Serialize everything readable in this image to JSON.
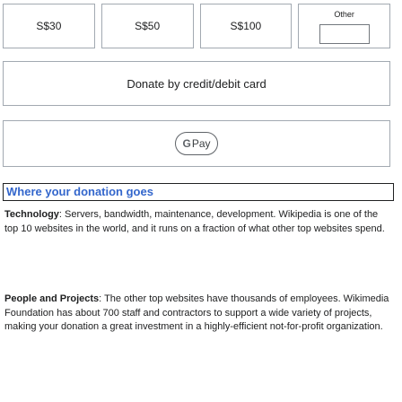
{
  "amounts": {
    "options": [
      "S$30",
      "S$50",
      "S$100"
    ],
    "other_label": "Other",
    "other_value": "",
    "other_placeholder": ""
  },
  "payment": {
    "card_label": "Donate by credit/debit card",
    "gpay_label": "Pay"
  },
  "section": {
    "heading": "Where your donation goes"
  },
  "paragraphs": [
    {
      "lead": "Technology",
      "text": ": Servers, bandwidth, maintenance, development. Wikipedia is one of the top 10 websites in the world, and it runs on a fraction of what other top websites spend."
    },
    {
      "lead": "People and Projects",
      "text": ": The other top websites have thousands of employees. Wikimedia Foundation has about 700 staff and contractors to support a wide variety of projects, making your donation a great investment in a highly-efficient not-for-profit organization."
    }
  ],
  "colors": {
    "heading_link": "#3366cc",
    "border": "#a2a9b1",
    "text": "#202122"
  },
  "icons": {
    "gpay": "google-pay-icon"
  }
}
